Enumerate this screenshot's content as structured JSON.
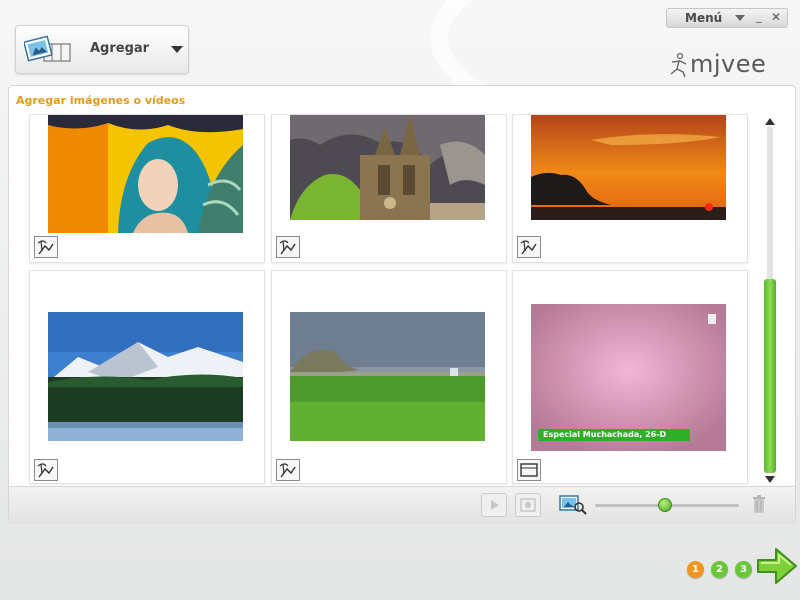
{
  "window": {
    "menu_label": "Menú",
    "minimize_glyph": "_",
    "close_glyph": "✕"
  },
  "toolbar": {
    "add_label": "Agregar"
  },
  "brand": {
    "logo_text": "mjvee"
  },
  "panel": {
    "title": "Agregar imágenes o vídeos"
  },
  "media": [
    {
      "type": "photo",
      "subject": "fantasy-art"
    },
    {
      "type": "photo",
      "subject": "cathedral"
    },
    {
      "type": "photo",
      "subject": "sunset"
    },
    {
      "type": "photo",
      "subject": "mountains"
    },
    {
      "type": "photo",
      "subject": "meadow"
    },
    {
      "type": "video",
      "caption": "Especial Muchachada, 26-D"
    }
  ],
  "zoom": {
    "level": 0.48
  },
  "scroll": {
    "position": 1.0
  },
  "steps": [
    {
      "label": "1",
      "state": "active"
    },
    {
      "label": "2",
      "state": "pending"
    },
    {
      "label": "3",
      "state": "pending"
    }
  ],
  "colors": {
    "accent": "#e49a17",
    "active_step": "#f0951e",
    "pending_step": "#6cc63b",
    "scrollbar": "#6cc63b"
  }
}
